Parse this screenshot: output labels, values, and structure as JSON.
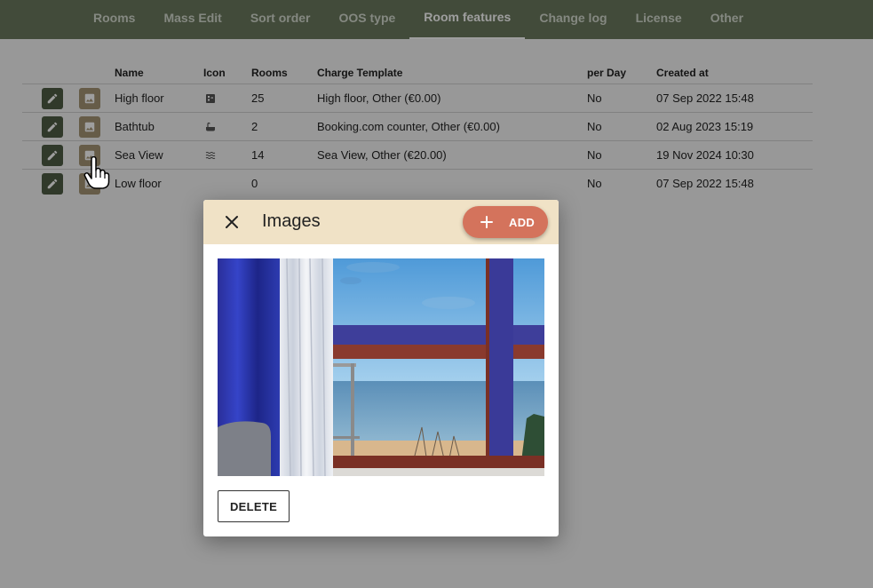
{
  "nav": {
    "tabs": [
      {
        "label": "Rooms"
      },
      {
        "label": "Mass Edit"
      },
      {
        "label": "Sort order"
      },
      {
        "label": "OOS type"
      },
      {
        "label": "Room features"
      },
      {
        "label": "Change log"
      },
      {
        "label": "License"
      },
      {
        "label": "Other"
      }
    ],
    "active_index": 4
  },
  "table": {
    "headers": {
      "name": "Name",
      "icon": "Icon",
      "rooms": "Rooms",
      "charge_template": "Charge Template",
      "per_day": "per Day",
      "created_at": "Created at"
    },
    "rows": [
      {
        "name": "High floor",
        "icon": "floor-plan-icon",
        "rooms": "25",
        "charge_template": "High floor, Other (€0.00)",
        "per_day": "No",
        "created_at": "07 Sep 2022 15:48"
      },
      {
        "name": "Bathtub",
        "icon": "bathtub-icon",
        "rooms": "2",
        "charge_template": "Booking.com counter, Other (€0.00)",
        "per_day": "No",
        "created_at": "02 Aug 2023 15:19"
      },
      {
        "name": "Sea View",
        "icon": "waves-icon",
        "rooms": "14",
        "charge_template": "Sea View, Other (€20.00)",
        "per_day": "No",
        "created_at": "19 Nov 2024 10:30"
      },
      {
        "name": "Low floor",
        "icon": "",
        "rooms": "0",
        "charge_template": "",
        "per_day": "No",
        "created_at": "07 Sep 2022 15:48"
      }
    ]
  },
  "dialog": {
    "title": "Images",
    "add_label": "ADD",
    "delete_label": "DELETE"
  },
  "colors": {
    "nav_bg": "#6b7a5e",
    "edit_btn": "#4e5c44",
    "image_btn": "#a59575",
    "dialog_header": "#f0e2c6",
    "add_btn": "#d4735c"
  }
}
